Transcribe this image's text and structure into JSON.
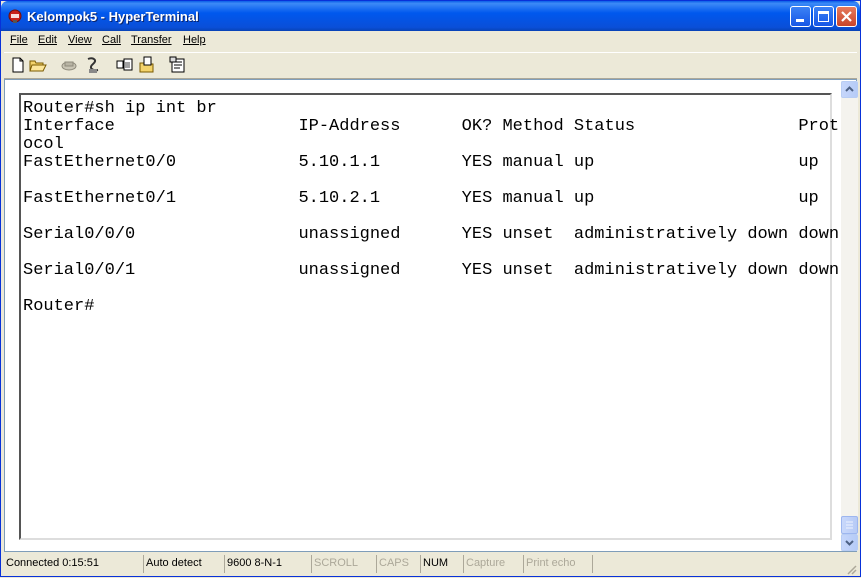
{
  "window": {
    "title": "Kelompok5 - HyperTerminal",
    "app_icon": "hyperterminal-icon",
    "controls": [
      "minimize-icon",
      "maximize-icon",
      "close-icon"
    ]
  },
  "menu": [
    {
      "label": "File"
    },
    {
      "label": "Edit"
    },
    {
      "label": "View"
    },
    {
      "label": "Call"
    },
    {
      "label": "Transfer"
    },
    {
      "label": "Help"
    }
  ],
  "toolbar": [
    "new-icon",
    "open-icon",
    "call-icon",
    "disconnect-icon",
    "send-icon",
    "receive-icon",
    "properties-icon"
  ],
  "terminal": {
    "lines": [
      "Router#sh ip int br",
      "Interface                  IP-Address      OK? Method Status                Prot",
      "ocol",
      "FastEthernet0/0            5.10.1.1        YES manual up                    up",
      "",
      "FastEthernet0/1            5.10.2.1        YES manual up                    up",
      "",
      "Serial0/0/0                unassigned      YES unset  administratively down down",
      "",
      "Serial0/0/1                unassigned      YES unset  administratively down down",
      "",
      "Router#"
    ]
  },
  "status": {
    "connected": "Connected 0:15:51",
    "detect": "Auto detect",
    "settings": "9600 8-N-1",
    "scroll": "SCROLL",
    "caps": "CAPS",
    "num": "NUM",
    "capture": "Capture",
    "print_echo": "Print echo"
  },
  "colors": {
    "titlebar": "#0058EE",
    "window_bg": "#ECE9D8",
    "terminal_bg": "#FFFFFF",
    "terminal_text": "#000000",
    "inactive_status_text": "#ACA899"
  }
}
